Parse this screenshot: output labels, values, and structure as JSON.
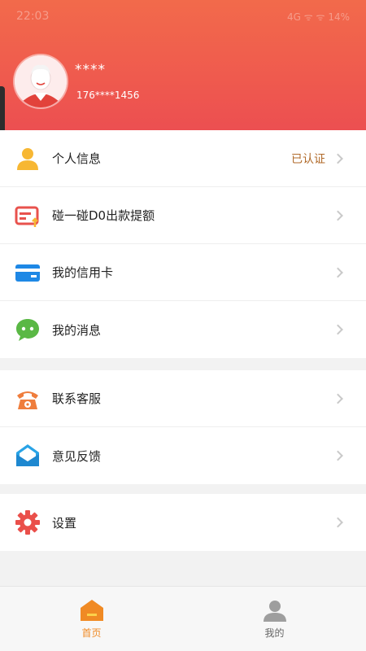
{
  "status_bar": {
    "time": "22:03",
    "indicators": "4G ᯤ ᯤ 14%"
  },
  "profile": {
    "name": "****",
    "phone": "176****1456"
  },
  "menu_groups": [
    {
      "items": [
        {
          "label": "个人信息",
          "badge": "已认证",
          "icon": "person-icon"
        },
        {
          "label": "碰一碰D0出款提额",
          "badge": "",
          "icon": "card-limit-icon"
        },
        {
          "label": "我的信用卡",
          "badge": "",
          "icon": "credit-card-icon"
        },
        {
          "label": "我的消息",
          "badge": "",
          "icon": "message-icon"
        }
      ]
    },
    {
      "items": [
        {
          "label": "联系客服",
          "badge": "",
          "icon": "phone-icon"
        },
        {
          "label": "意见反馈",
          "badge": "",
          "icon": "envelope-icon"
        }
      ]
    },
    {
      "items": [
        {
          "label": "设置",
          "badge": "",
          "icon": "gear-icon"
        }
      ]
    }
  ],
  "tabbar": {
    "home_label": "首页",
    "mine_label": "我的"
  },
  "colors": {
    "header_top": "#f26a4b",
    "header_bottom": "#ec4f51",
    "active_tab": "#f08a24",
    "verified_text": "#b06a2a"
  }
}
